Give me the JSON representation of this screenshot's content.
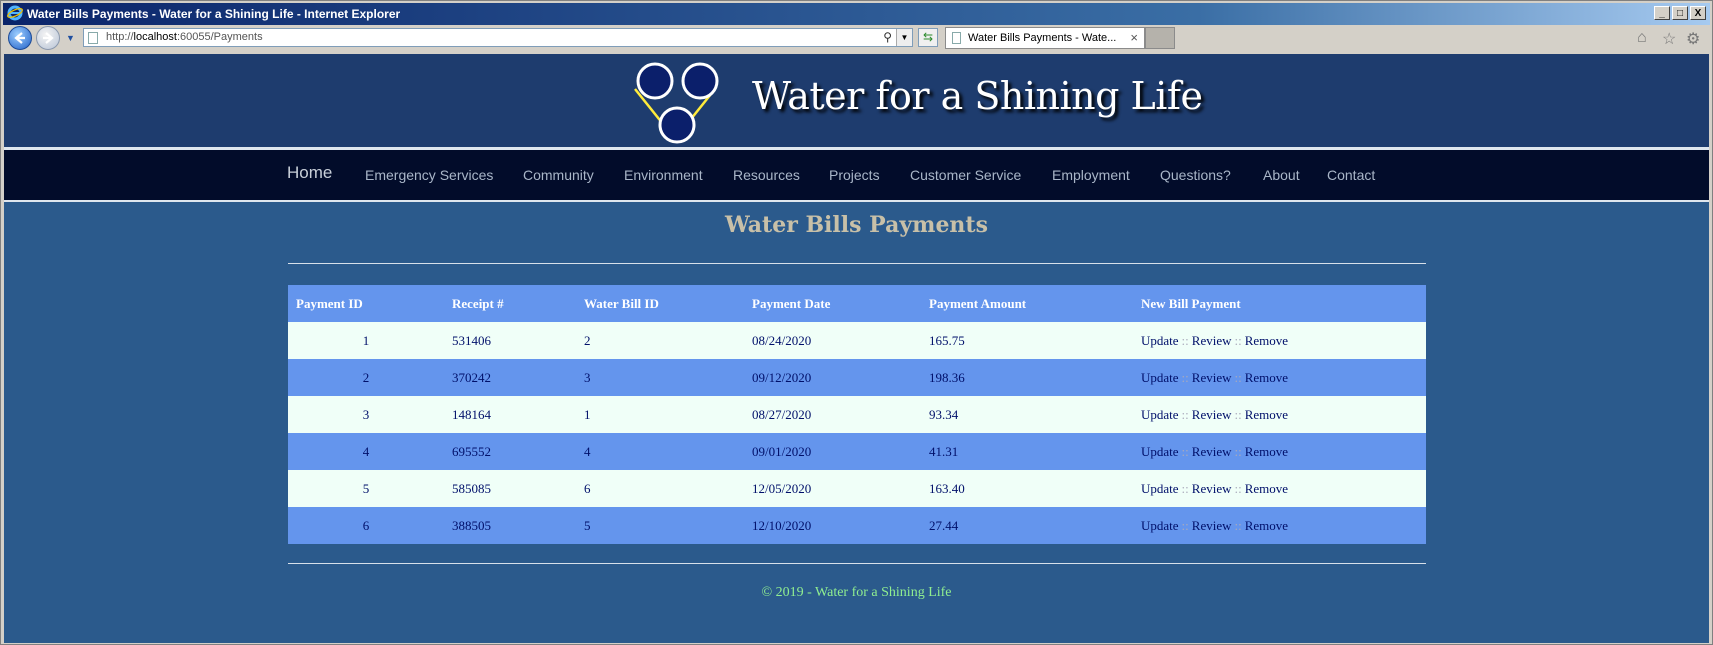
{
  "browser": {
    "window_title": "Water Bills Payments - Water for a Shining Life - Internet Explorer",
    "url_prefix": "http://",
    "url_host": "localhost",
    "url_rest": ":60055/Payments",
    "tab_label": "Water Bills Payments - Wate...",
    "min_label": "_",
    "max_label": "□",
    "close_label": "X",
    "tab_close": "×"
  },
  "site": {
    "title": "Water for a Shining Life",
    "nav": [
      "Home",
      "Emergency Services",
      "Community",
      "Environment",
      "Resources",
      "Projects",
      "Customer Service",
      "Employment",
      "Questions?",
      "About",
      "Contact"
    ]
  },
  "main": {
    "heading": "Water Bills Payments",
    "columns": [
      "Payment ID",
      "Receipt #",
      "Water Bill ID",
      "Payment Date",
      "Payment Amount",
      "New Bill Payment"
    ],
    "rows": [
      {
        "id": "1",
        "receipt": "531406",
        "bill": "2",
        "date": "08/24/2020",
        "amount": "165.75"
      },
      {
        "id": "2",
        "receipt": "370242",
        "bill": "3",
        "date": "09/12/2020",
        "amount": "198.36"
      },
      {
        "id": "3",
        "receipt": "148164",
        "bill": "1",
        "date": "08/27/2020",
        "amount": "93.34"
      },
      {
        "id": "4",
        "receipt": "695552",
        "bill": "4",
        "date": "09/01/2020",
        "amount": "41.31"
      },
      {
        "id": "5",
        "receipt": "585085",
        "bill": "6",
        "date": "12/05/2020",
        "amount": "163.40"
      },
      {
        "id": "6",
        "receipt": "388505",
        "bill": "5",
        "date": "12/10/2020",
        "amount": "27.44"
      }
    ],
    "actions": {
      "update": "Update",
      "review": "Review",
      "remove": "Remove",
      "separator": "::"
    }
  },
  "footer": "© 2019 - Water for a Shining Life",
  "colors": {
    "header": "#1e3c6e",
    "nav": "#020c2a",
    "page": "#2b5a8c",
    "table_header": "#6495ed",
    "row_light": "#f0fff8",
    "footer_text": "#90ee90"
  }
}
